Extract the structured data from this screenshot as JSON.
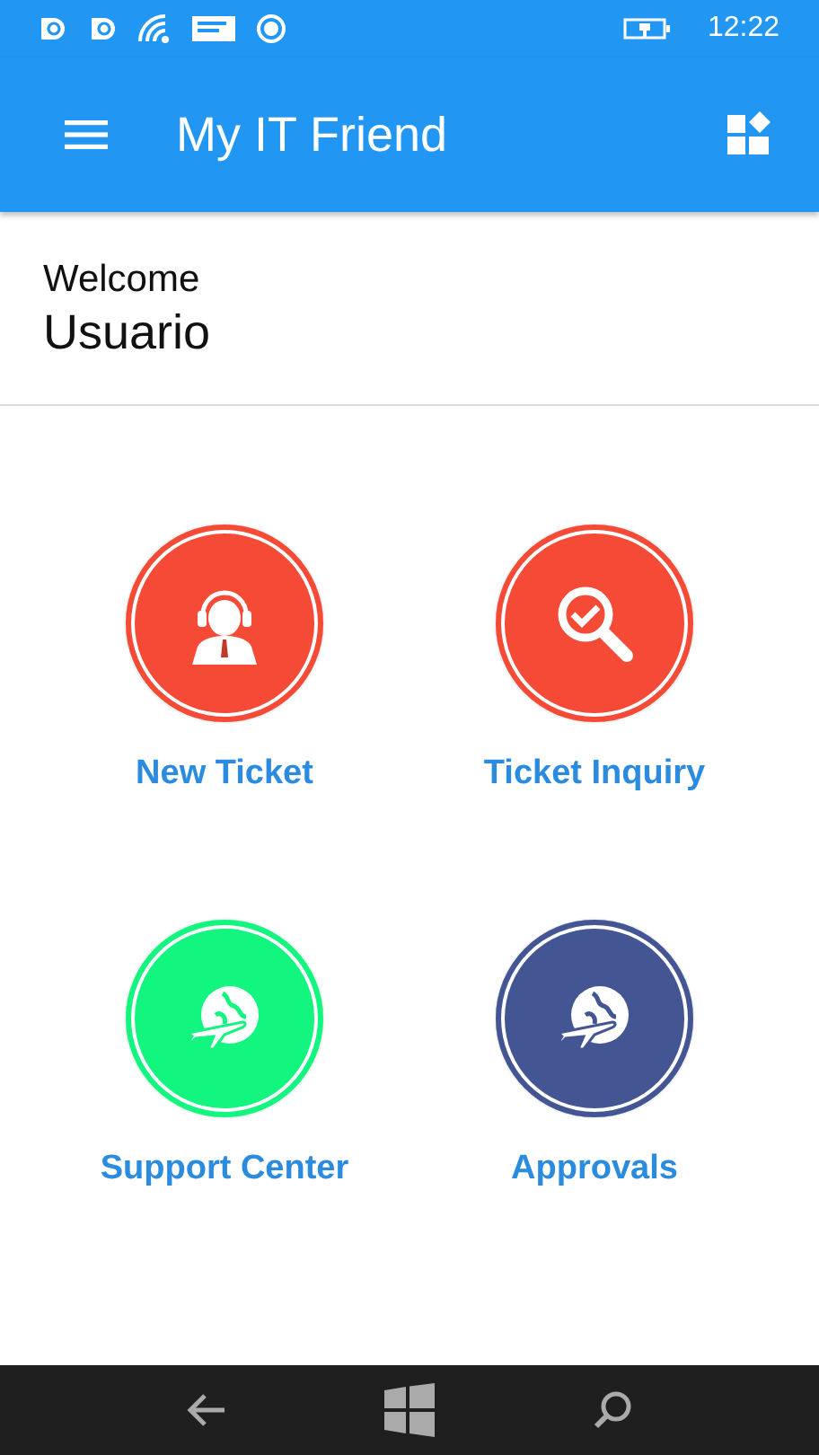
{
  "status_bar": {
    "time": "12:22"
  },
  "app_bar": {
    "title": "My IT Friend"
  },
  "welcome": {
    "greeting": "Welcome",
    "user": "Usuario"
  },
  "tiles": [
    {
      "label": "New Ticket",
      "kind": "headset",
      "color": "#f44a36"
    },
    {
      "label": "Ticket Inquiry",
      "kind": "search",
      "color": "#f44a36"
    },
    {
      "label": "Support Center",
      "kind": "globe",
      "color": "#12f57e"
    },
    {
      "label": "Approvals",
      "kind": "globe",
      "color": "#435593"
    }
  ]
}
